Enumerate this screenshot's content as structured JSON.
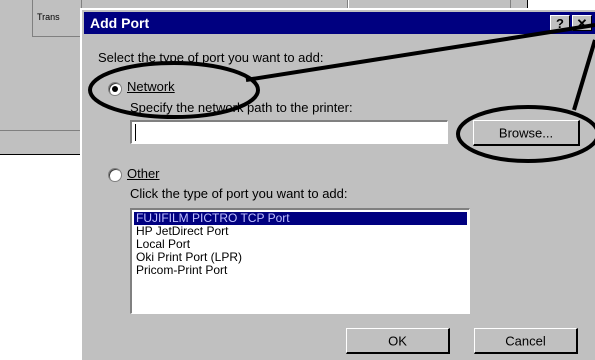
{
  "background_window": {
    "label_fragment": "Trans"
  },
  "dialog": {
    "title": "Add Port",
    "help_glyph": "?",
    "close_glyph": "✕",
    "prompt": "Select the type of port you want to add:",
    "network": {
      "label": "Network",
      "selected": true,
      "path_label": "Specify the network path to the printer:",
      "path_value": "",
      "browse_label": "Browse..."
    },
    "other": {
      "label": "Other",
      "selected": false,
      "list_label": "Click the type of port you want to add:",
      "ports": [
        "FUJIFILM PICTRO TCP Port",
        "HP JetDirect Port",
        "Local Port",
        "Oki Print Port (LPR)",
        "Pricom-Print Port"
      ],
      "selected_port": "FUJIFILM PICTRO TCP Port"
    },
    "ok_label": "OK",
    "cancel_label": "Cancel"
  },
  "colors": {
    "title_bar": "#000080",
    "dialog_bg": "#c0c0c0",
    "list_selection": "#000080"
  }
}
